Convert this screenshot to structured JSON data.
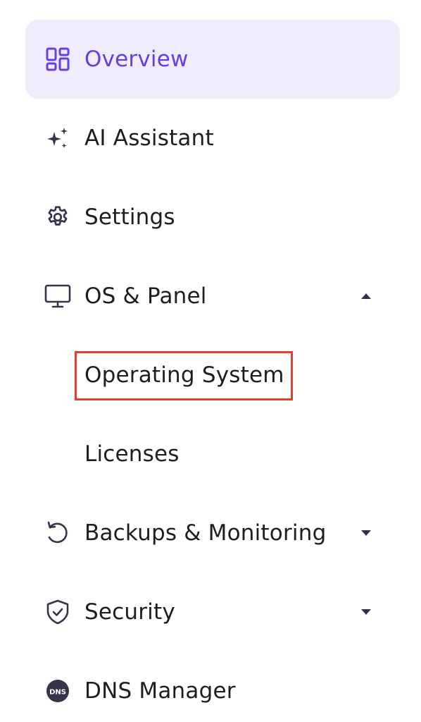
{
  "nav": {
    "overview": {
      "label": "Overview",
      "icon": "grid-icon",
      "active": true
    },
    "ai_assistant": {
      "label": "AI Assistant",
      "icon": "sparkles-icon"
    },
    "settings": {
      "label": "Settings",
      "icon": "gear-icon"
    },
    "os_panel": {
      "label": "OS & Panel",
      "icon": "monitor-icon",
      "expanded": true,
      "children": [
        {
          "label": "Operating System",
          "highlighted": true
        },
        {
          "label": "Licenses"
        }
      ]
    },
    "backups": {
      "label": "Backups & Monitoring",
      "icon": "restore-icon",
      "expanded": false
    },
    "security": {
      "label": "Security",
      "icon": "shield-check-icon",
      "expanded": false
    },
    "dns": {
      "label": "DNS Manager",
      "icon": "dns-icon",
      "icon_text": "DNS"
    }
  },
  "colors": {
    "accent": "#673de6",
    "active_bg": "#efedfc",
    "text": "#1d1e20",
    "icon": "#36344d",
    "highlight_border": "#e0402e"
  }
}
